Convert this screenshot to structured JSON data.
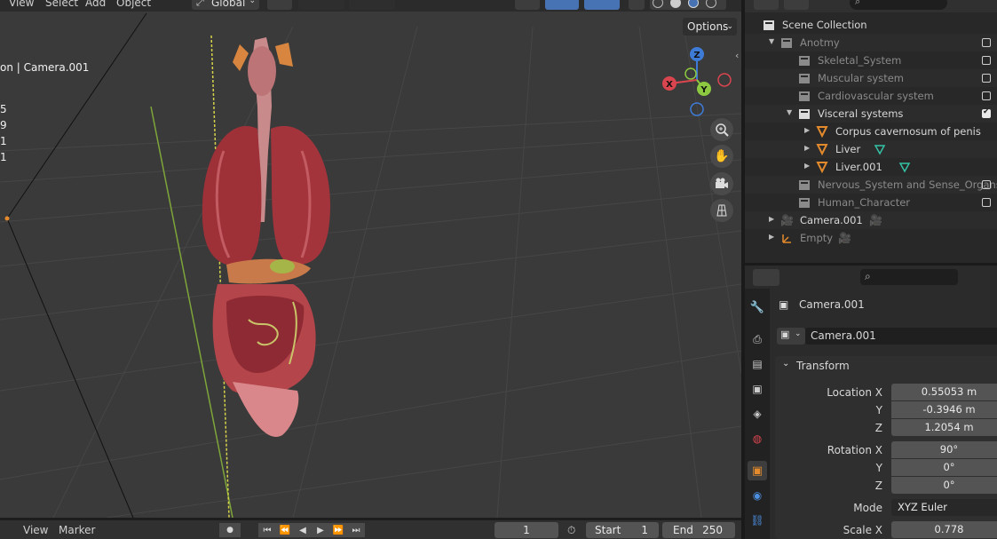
{
  "viewport": {
    "menu": [
      "View",
      "Select",
      "Add",
      "Object"
    ],
    "transform_orientation": "Global",
    "camera_overlay_title": "on | Camera.001",
    "stats": [
      "5",
      "9",
      "1",
      "1"
    ],
    "options_label": "Options",
    "gizmo": {
      "z": "Z",
      "x": "X",
      "y": "Y"
    }
  },
  "timeline": {
    "menu": [
      "View",
      "Marker"
    ],
    "current_frame": "1",
    "start_label": "Start",
    "start_value": "1",
    "end_label": "End",
    "end_value": "250"
  },
  "outliner": {
    "rows": [
      {
        "label": "Scene Collection",
        "indent": 0,
        "dim": false
      },
      {
        "label": "Anotmy",
        "indent": 1,
        "dim": true,
        "check": false,
        "tri": "▼"
      },
      {
        "label": "Skeletal_System",
        "indent": 2,
        "dim": true,
        "check": false
      },
      {
        "label": "Muscular system",
        "indent": 2,
        "dim": true,
        "check": false
      },
      {
        "label": "Cardiovascular system",
        "indent": 2,
        "dim": true,
        "check": false
      },
      {
        "label": "Visceral systems",
        "indent": 2,
        "dim": false,
        "check": true,
        "tri": "▼"
      },
      {
        "label": "Corpus cavernosum of penis",
        "indent": 3,
        "dim": false,
        "tri": "▶"
      },
      {
        "label": "Liver",
        "indent": 3,
        "dim": false,
        "tri": "▶"
      },
      {
        "label": "Liver.001",
        "indent": 3,
        "dim": false,
        "tri": "▶"
      },
      {
        "label": "Nervous_System and Sense_Organs",
        "indent": 2,
        "dim": true,
        "check": false
      },
      {
        "label": "Human_Character",
        "indent": 2,
        "dim": true,
        "check": false
      },
      {
        "label": "Camera.001",
        "indent": 1,
        "dim": false,
        "tri": "▶"
      },
      {
        "label": "Empty",
        "indent": 1,
        "dim": true,
        "tri": "▶"
      }
    ]
  },
  "properties": {
    "object_name": "Camera.001",
    "datablock_name": "Camera.001",
    "section": "Transform",
    "location": {
      "label": "Location X",
      "x": "0.55053 m",
      "y_label": "Y",
      "y": "-0.3946 m",
      "z_label": "Z",
      "z": "1.2054 m"
    },
    "rotation": {
      "label": "Rotation X",
      "x": "90°",
      "y_label": "Y",
      "y": "0°",
      "z_label": "Z",
      "z": "0°"
    },
    "mode_label": "Mode",
    "mode_value": "XYZ Euler",
    "scale_label": "Scale X",
    "scale_x": "0.778"
  },
  "colors": {
    "selection": "#334d80",
    "accent": "#e38a2c",
    "x_axis": "#d9454f",
    "y_axis": "#8cc940",
    "z_axis": "#3e7bd6"
  }
}
